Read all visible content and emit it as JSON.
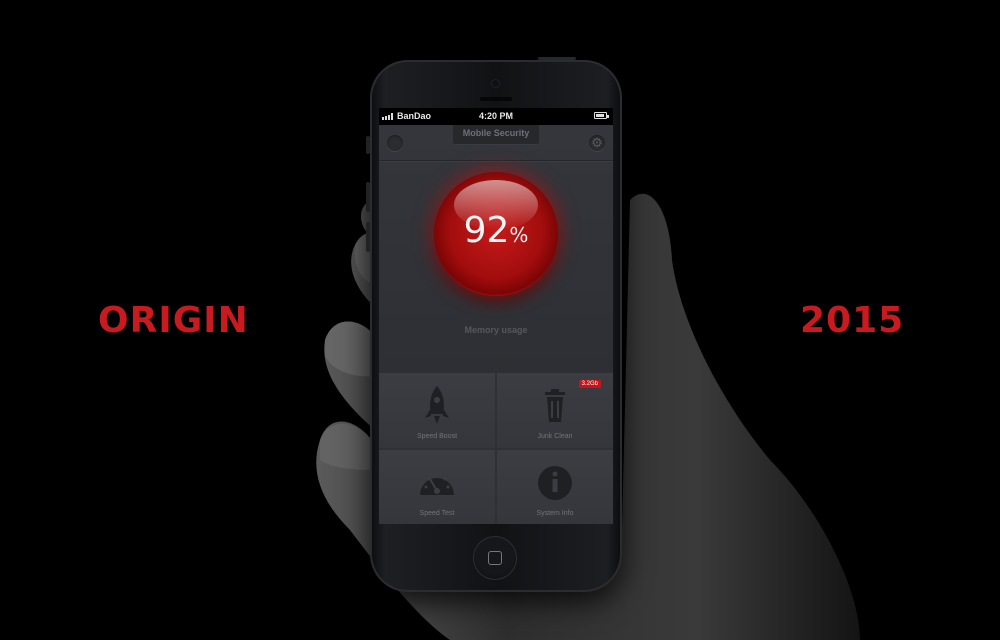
{
  "left_word": "ORIGIN",
  "right_word": "2015",
  "accent_color": "#c81b1f",
  "status_bar": {
    "carrier": "BanDao",
    "time": "4:20 PM"
  },
  "app": {
    "title": "Mobile Security",
    "memory_value": "92",
    "memory_unit": "%",
    "memory_label": "Memory usage",
    "tiles": [
      {
        "label": "Speed Boost",
        "icon": "rocket-icon"
      },
      {
        "label": "Junk Clean",
        "icon": "trash-icon",
        "badge": "3.2Gb"
      },
      {
        "label": "Speed Test",
        "icon": "speedometer-icon"
      },
      {
        "label": "System Info",
        "icon": "info-icon"
      }
    ]
  }
}
